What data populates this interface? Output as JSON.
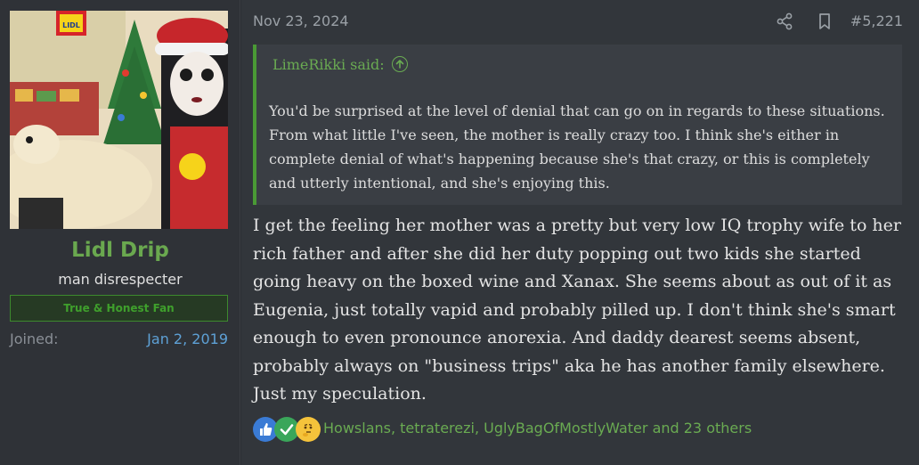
{
  "user": {
    "name": "Lidl Drip",
    "title": "man disrespecter",
    "banner": "True & Honest Fan",
    "joined_label": "Joined:",
    "joined_value": "Jan 2, 2019",
    "avatar_icon": "avatar-image",
    "avatar_logo_text": "LIDL"
  },
  "post": {
    "date": "Nov 23, 2024",
    "number": "#5,221",
    "share_icon": "share-icon",
    "bookmark_icon": "bookmark-icon",
    "quote": {
      "header": "LimeRikki said:",
      "body": "You'd be surprised at the level of denial that can go on in regards to these situations. From what little I've seen, the mother is really crazy too. I think she's either in complete denial of what's happening because she's that crazy, or this is completely and utterly intentional, and she's enjoying this."
    },
    "message": "I get the feeling her mother was a pretty but very low IQ trophy wife to her rich father and after she did her duty popping out two kids she started going heavy on the boxed wine and Xanax. She seems about as out of it as Eugenia, just totally vapid and probably pilled up. I don't think she's smart enough to even pronounce anorexia. And daddy dearest seems absent, probably always on \"business trips\" aka he has another family elsewhere. Just my speculation.",
    "reactions": {
      "icons": [
        "thumbs-up-icon",
        "checkmark-icon",
        "thinking-face-icon"
      ],
      "names": "Howslans, tetraterezi, UglyBagOfMostlyWater and 23 others"
    }
  },
  "colors": {
    "accent_green": "#6aab52",
    "link_blue": "#5ea1d6",
    "background": "#32363b",
    "sidebar": "#2f3237"
  }
}
